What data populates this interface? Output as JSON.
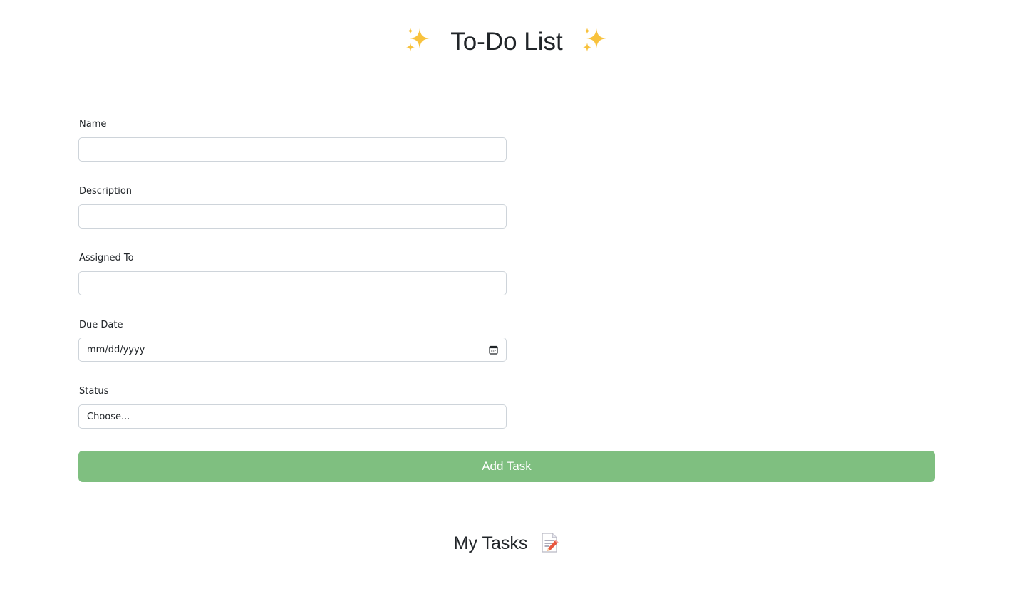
{
  "header": {
    "title": "To-Do List",
    "left_icon": "sparkles-icon",
    "right_icon": "sparkles-icon"
  },
  "form": {
    "name": {
      "label": "Name",
      "value": ""
    },
    "description": {
      "label": "Description",
      "value": ""
    },
    "assigned_to": {
      "label": "Assigned To",
      "value": ""
    },
    "due_date": {
      "label": "Due Date",
      "placeholder": "mm/dd/yyyy",
      "icon": "calendar-icon"
    },
    "status": {
      "label": "Status",
      "selected": "Choose..."
    },
    "submit_label": "Add Task"
  },
  "tasks": {
    "heading": "My Tasks",
    "icon": "memo-icon"
  },
  "colors": {
    "accent": "#7fbf80",
    "sparkle": "#f5c04a",
    "border": "#ced4da"
  }
}
